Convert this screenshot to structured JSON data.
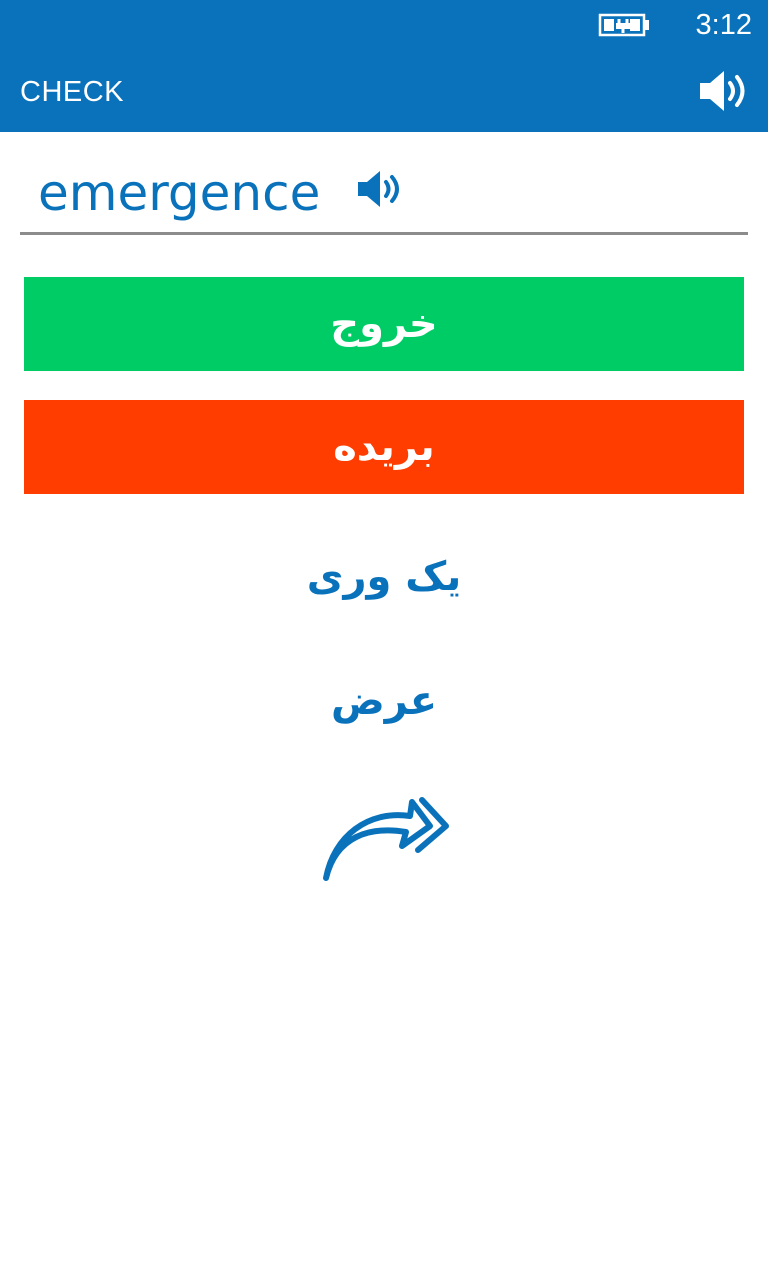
{
  "status_bar": {
    "time": "3:12",
    "battery_icon": "battery-charging-icon"
  },
  "header": {
    "title": "CHECK",
    "speaker_icon": "speaker-icon"
  },
  "word": {
    "text": "emergence",
    "speaker_icon": "speaker-icon"
  },
  "options": [
    {
      "label": "خروج",
      "color": "#00cc66"
    },
    {
      "label": "بریده",
      "color": "#ff3d00"
    },
    {
      "label": "یک وری"
    },
    {
      "label": "عرض"
    }
  ],
  "next_icon": "forward-arrow-icon",
  "colors": {
    "accent": "#0a72ba",
    "correct": "#00cc66",
    "wrong": "#ff3d00"
  }
}
